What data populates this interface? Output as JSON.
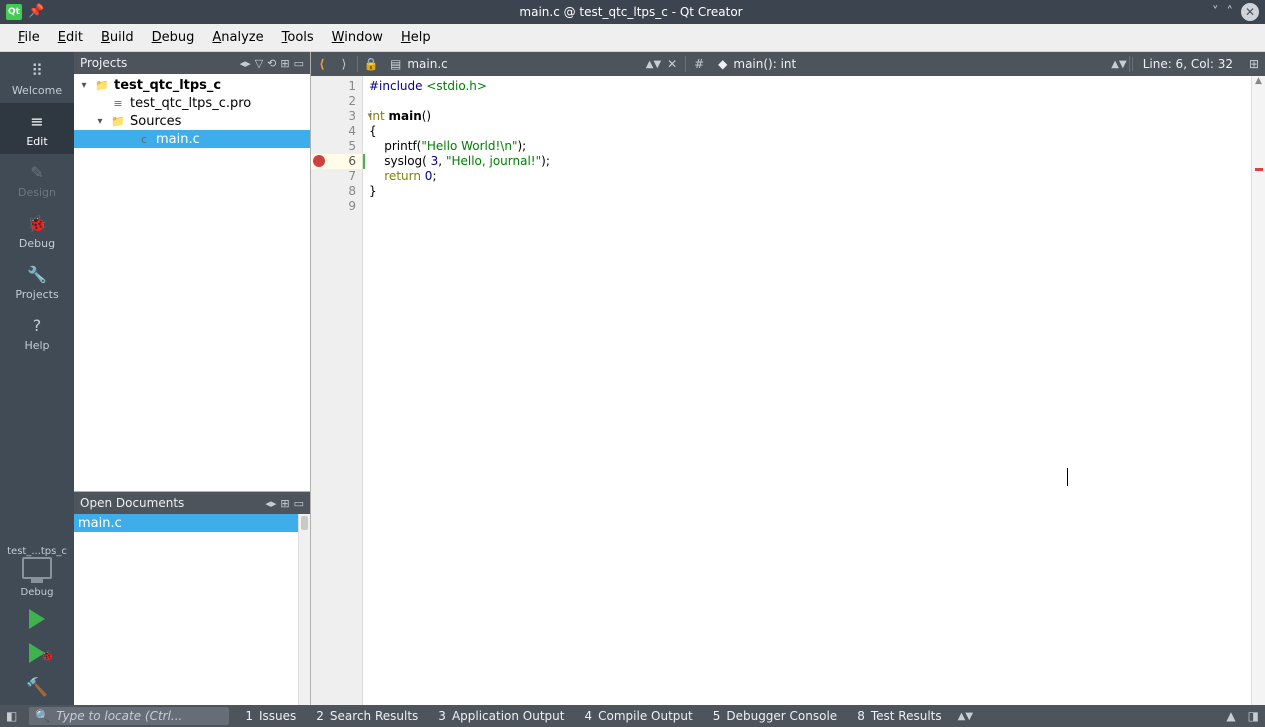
{
  "window": {
    "title": "main.c @ test_qtc_ltps_c - Qt Creator"
  },
  "menu": {
    "items": [
      "File",
      "Edit",
      "Build",
      "Debug",
      "Analyze",
      "Tools",
      "Window",
      "Help"
    ]
  },
  "rail": {
    "items": [
      {
        "label": "Welcome",
        "icon": "⠿"
      },
      {
        "label": "Edit",
        "icon": "≡",
        "active": true
      },
      {
        "label": "Design",
        "icon": "✎",
        "disabled": true
      },
      {
        "label": "Debug",
        "icon": "🐞"
      },
      {
        "label": "Projects",
        "icon": "🔧"
      },
      {
        "label": "Help",
        "icon": "?"
      }
    ],
    "kit_label": "test_...tps_c",
    "mode_label": "Debug"
  },
  "projects_panel": {
    "title": "Projects",
    "tree": [
      {
        "label": "test_qtc_ltps_c",
        "bold": true,
        "expand": true,
        "indent": 0,
        "icon": "proj"
      },
      {
        "label": "test_qtc_ltps_c.pro",
        "indent": 1,
        "icon": "pro"
      },
      {
        "label": "Sources",
        "expand": true,
        "indent": 1,
        "icon": "folder"
      },
      {
        "label": "main.c",
        "indent": 2,
        "selected": true,
        "icon": "c"
      }
    ]
  },
  "open_docs": {
    "title": "Open Documents",
    "items": [
      {
        "label": "main.c",
        "selected": true
      }
    ]
  },
  "editor_toolbar": {
    "file_label": "main.c",
    "func_label": "main(): int",
    "line_col": "Line: 6, Col: 32"
  },
  "code": {
    "lines": [
      {
        "n": 1,
        "html": "<span class='kw-pp'>#include</span> <span class='kw-inc'>&lt;stdio.h&gt;</span>"
      },
      {
        "n": 2,
        "html": ""
      },
      {
        "n": 3,
        "html": "<span class='kw-type'>int</span> <span class='kw-func'>main</span>()",
        "fold": true
      },
      {
        "n": 4,
        "html": "{"
      },
      {
        "n": 5,
        "html": "    printf(<span class='kw-str'>\"Hello World!\\n\"</span>);"
      },
      {
        "n": 6,
        "html": "    syslog( <span class='kw-num'>3</span>, <span class='kw-str'>\"Hello, journal!\"</span>);",
        "current": true,
        "breakpoint": true,
        "greenbar": true
      },
      {
        "n": 7,
        "html": "    <span class='kw-ret'>return</span> <span class='kw-num'>0</span>;"
      },
      {
        "n": 8,
        "html": "}"
      },
      {
        "n": 9,
        "html": ""
      }
    ]
  },
  "statusbar": {
    "locator_placeholder": "Type to locate (Ctrl...",
    "panes": [
      {
        "n": "1",
        "label": "Issues"
      },
      {
        "n": "2",
        "label": "Search Results"
      },
      {
        "n": "3",
        "label": "Application Output"
      },
      {
        "n": "4",
        "label": "Compile Output"
      },
      {
        "n": "5",
        "label": "Debugger Console"
      },
      {
        "n": "8",
        "label": "Test Results"
      }
    ]
  }
}
